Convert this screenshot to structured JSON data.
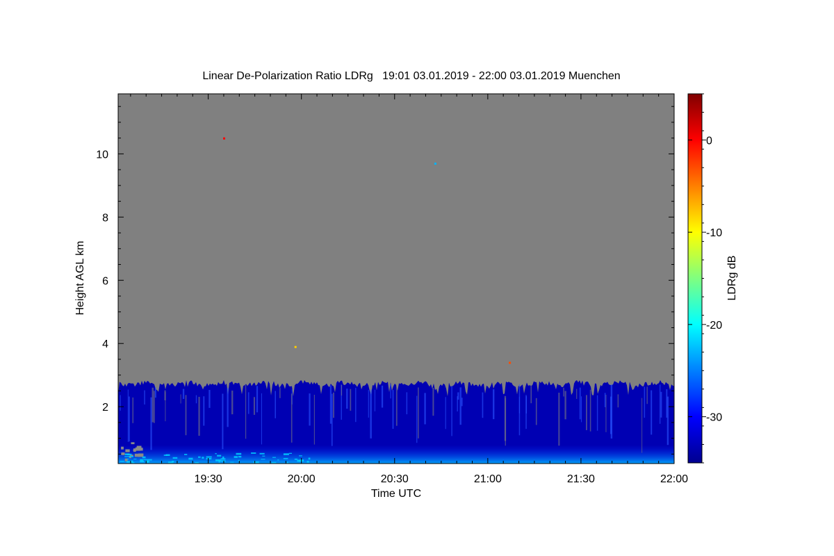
{
  "chart_data": {
    "type": "heatmap",
    "title": "Linear De-Polarization Ratio LDRg   19:01 03.01.2019 - 22:00 03.01.2019 Muenchen",
    "xlabel": "Time UTC",
    "ylabel": "Height AGL km",
    "x_ticks": [
      "19:30",
      "20:00",
      "20:30",
      "21:00",
      "21:30",
      "22:00"
    ],
    "xlim": [
      "19:01",
      "22:00"
    ],
    "y_ticks": [
      2,
      4,
      6,
      8,
      10
    ],
    "ylim": [
      0.2,
      11.9
    ],
    "colorbar": {
      "label": "LDRg dB",
      "ticks": [
        0,
        -10,
        -20,
        -30
      ],
      "range": [
        -35,
        5
      ],
      "colormap": "jet"
    },
    "background_color": "#808080",
    "signal_top_km": 2.8,
    "typical_ldr_db": -33,
    "near_surface_ldr_db": -22,
    "isolated_points": [
      {
        "time": "19:35",
        "height_km": 10.5,
        "ldr_db": 0
      },
      {
        "time": "20:43",
        "height_km": 9.7,
        "ldr_db": -23
      },
      {
        "time": "19:58",
        "height_km": 3.9,
        "ldr_db": -8
      },
      {
        "time": "21:07",
        "height_km": 3.4,
        "ldr_db": -3
      }
    ]
  }
}
